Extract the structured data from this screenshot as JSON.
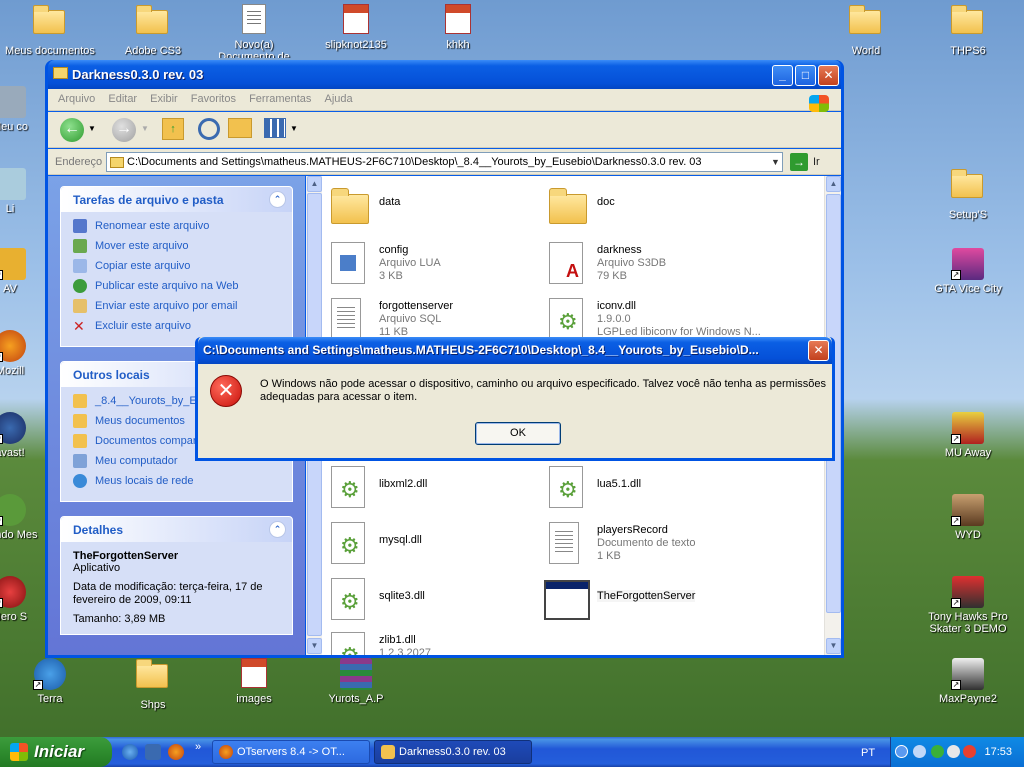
{
  "desktop": {
    "icons": [
      {
        "label": "Meus documentos",
        "kind": "mydocs"
      },
      {
        "label": "Adobe CS3",
        "kind": "folder"
      },
      {
        "label": "Novo(a) Documento de texto",
        "kind": "doc"
      },
      {
        "label": "slipknot2135",
        "kind": "ppt"
      },
      {
        "label": "khkh",
        "kind": "ppt"
      },
      {
        "label": "World",
        "kind": "folder"
      },
      {
        "label": "THPS6",
        "kind": "folder"
      },
      {
        "label": "Setup'S",
        "kind": "folder"
      },
      {
        "label": "GTA Vice City",
        "kind": "game"
      },
      {
        "label": "MU Away",
        "kind": "game"
      },
      {
        "label": "WYD",
        "kind": "game"
      },
      {
        "label": "Tony Hawks Pro Skater 3 DEMO",
        "kind": "game"
      },
      {
        "label": "MaxPayne2",
        "kind": "game"
      },
      {
        "label": "Terra",
        "kind": "game"
      },
      {
        "label": "Shps",
        "kind": "folder"
      },
      {
        "label": "images",
        "kind": "ppt"
      },
      {
        "label": "Yurots_A.P",
        "kind": "rar"
      },
      {
        "label": "Meu co",
        "kind": "partial"
      },
      {
        "label": "Li",
        "kind": "partial"
      },
      {
        "label": "AV",
        "kind": "partial"
      },
      {
        "label": "Mozill",
        "kind": "partial"
      },
      {
        "label": "avast!",
        "kind": "partial"
      },
      {
        "label": "Windo Mes",
        "kind": "partial"
      },
      {
        "label": "Nero S",
        "kind": "partial"
      }
    ]
  },
  "explorer": {
    "title": "Darkness0.3.0 rev. 03",
    "menu": [
      "Arquivo",
      "Editar",
      "Exibir",
      "Favoritos",
      "Ferramentas",
      "Ajuda"
    ],
    "address_label": "Endereço",
    "address_value": "C:\\Documents and Settings\\matheus.MATHEUS-2F6C710\\Desktop\\_8.4__Yourots_by_Eusebio\\Darkness0.3.0 rev. 03",
    "go_label": "Ir",
    "tasks_panel": {
      "title": "Tarefas de arquivo e pasta",
      "items": [
        {
          "label": "Renomear este arquivo",
          "icon": "rename-icon",
          "color": "#5577cc"
        },
        {
          "label": "Mover este arquivo",
          "icon": "move-icon",
          "color": "#6aa84f"
        },
        {
          "label": "Copiar este arquivo",
          "icon": "copy-icon",
          "color": "#9bb7e8"
        },
        {
          "label": "Publicar este arquivo na Web",
          "icon": "web-icon",
          "color": "#3c9c3c"
        },
        {
          "label": "Enviar este arquivo por email",
          "icon": "email-icon",
          "color": "#e6c06a"
        },
        {
          "label": "Excluir este arquivo",
          "icon": "delete-icon",
          "color": "#cc2222"
        }
      ]
    },
    "places_panel": {
      "title": "Outros locais",
      "items": [
        {
          "label": "_8.4__Yourots_by_E",
          "icon": "folder-icon",
          "color": "#f2c14e"
        },
        {
          "label": "Meus documentos",
          "icon": "mydocs-icon",
          "color": "#f2c14e"
        },
        {
          "label": "Documentos compar",
          "icon": "shared-docs-icon",
          "color": "#f2c14e"
        },
        {
          "label": "Meu computador",
          "icon": "computer-icon",
          "color": "#7fa2d8"
        },
        {
          "label": "Meus locais de rede",
          "icon": "network-icon",
          "color": "#3a8ad8"
        }
      ]
    },
    "details_panel": {
      "title": "Detalhes",
      "name": "TheForgottenServer",
      "type": "Aplicativo",
      "modified": "Data de modificação: terça-feira, 17 de fevereiro de 2009, 09:11",
      "size": "Tamanho: 3,89 MB"
    },
    "files": [
      {
        "name": "data",
        "sub1": "",
        "sub2": "",
        "icon": "folder"
      },
      {
        "name": "doc",
        "sub1": "",
        "sub2": "",
        "icon": "folder"
      },
      {
        "name": "config",
        "sub1": "Arquivo LUA",
        "sub2": "3 KB",
        "icon": "lua"
      },
      {
        "name": "darkness",
        "sub1": "Arquivo S3DB",
        "sub2": "79 KB",
        "icon": "s3db"
      },
      {
        "name": "forgottenserver",
        "sub1": "Arquivo SQL",
        "sub2": "11 KB",
        "icon": "txt"
      },
      {
        "name": "iconv.dll",
        "sub1": "1.9.0.0",
        "sub2": "LGPLed libiconv for Windows N...",
        "icon": "dll"
      },
      {
        "name": "libxml2.dll",
        "sub1": "",
        "sub2": "",
        "icon": "dll"
      },
      {
        "name": "lua5.1.dll",
        "sub1": "",
        "sub2": "",
        "icon": "dll"
      },
      {
        "name": "mysql.dll",
        "sub1": "",
        "sub2": "",
        "icon": "dll"
      },
      {
        "name": "playersRecord",
        "sub1": "Documento de texto",
        "sub2": "1 KB",
        "icon": "txt"
      },
      {
        "name": "sqlite3.dll",
        "sub1": "",
        "sub2": "",
        "icon": "dll"
      },
      {
        "name": "TheForgottenServer",
        "sub1": "",
        "sub2": "",
        "icon": "exe"
      },
      {
        "name": "zlib1.dll",
        "sub1": "1.2.3.2027",
        "sub2": "",
        "icon": "dll"
      }
    ]
  },
  "dialog": {
    "title": "C:\\Documents and Settings\\matheus.MATHEUS-2F6C710\\Desktop\\_8.4__Yourots_by_Eusebio\\D...",
    "message": "O Windows não pode acessar o dispositivo, caminho ou arquivo especificado. Talvez você não tenha as permissões adequadas para acessar o item.",
    "ok_label": "OK"
  },
  "taskbar": {
    "start_label": "Iniciar",
    "tasks": [
      {
        "label": "OTservers 8.4 -> OT...",
        "icon": "firefox-icon",
        "color": "#e66000"
      },
      {
        "label": "Darkness0.3.0 rev. 03",
        "icon": "folder-icon",
        "color": "#f2c14e"
      }
    ],
    "language": "PT",
    "clock": "17:53"
  }
}
